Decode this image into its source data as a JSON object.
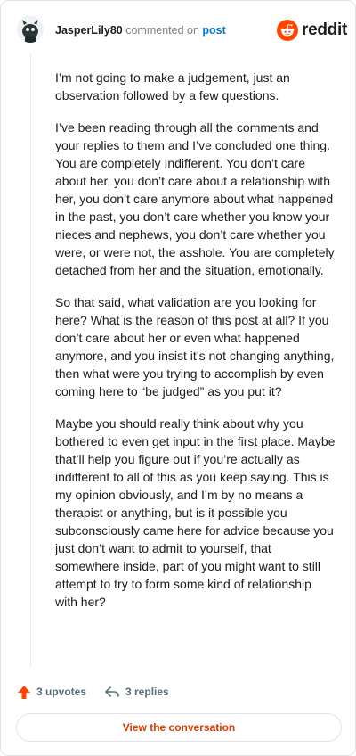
{
  "header": {
    "username": "JasperLily80",
    "action_text": "commented on",
    "post_link": "post",
    "brand": "reddit"
  },
  "comment": {
    "paragraphs": [
      "I’m not going to make a judgement, just an observation followed by a few questions.",
      "I’ve been reading through all the comments and your replies to them and I’ve concluded one thing. You are completely Indifferent. You don’t care about her, you don’t care about a relationship with her, you don’t care anymore about what happened in the past, you don’t care whether you know your nieces and nephews, you don’t care whether you were, or were not, the asshole. You are completely detached from her and the situation, emotionally.",
      "So that said, what validation are you looking for here? What is the reason of this post at all? If you don’t care about her or even what happened anymore, and you insist it’s not changing anything, then what were you trying to accomplish by even coming here to “be judged” as you put it?",
      "Maybe you should really think about why you bothered to even get input in the first place. Maybe that’ll help you figure out if you’re actually as indifferent to all of this as you keep saying. This is my opinion obviously, and I’m by no means a therapist or anything, but is it possible you subconsciously came here for advice because you just don’t want to admit to yourself, that somewhere inside, part of you might want to still attempt to try to form some kind of relationship with her?"
    ]
  },
  "actions": {
    "upvotes": "3 upvotes",
    "replies": "3 replies"
  },
  "cta": {
    "label": "View the conversation"
  },
  "colors": {
    "accent_orange": "#ff4500",
    "link_blue": "#0079d3",
    "cta_text": "#d93a00"
  },
  "icons": {
    "avatar": "snoo-avatar",
    "logo": "reddit-snoo-icon",
    "upvote": "upvote-arrow-icon",
    "reply": "reply-arrow-icon"
  }
}
